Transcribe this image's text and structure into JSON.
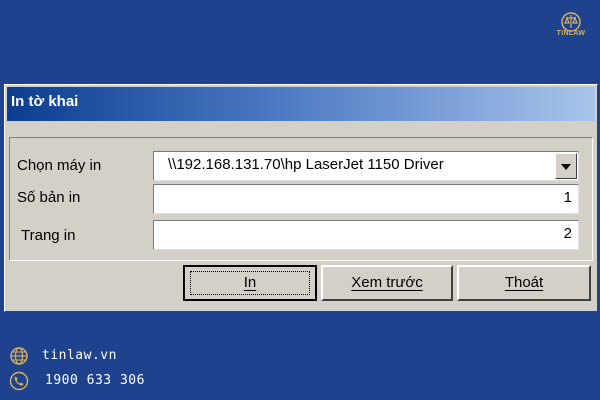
{
  "brand": {
    "logo_text": "TINLAW",
    "accent_color": "#d8b25a",
    "background_color": "#1e428e"
  },
  "dialog": {
    "title": "In tờ khai",
    "printer_label": "Chọn máy in",
    "printer_value": "\\\\192.168.131.70\\hp LaserJet 1150 Driver",
    "copies_label": "Số bản in",
    "copies_value": "1",
    "page_label": "Trang in",
    "page_value": "2",
    "buttons": {
      "print": "In",
      "preview": "Xem trước",
      "exit": "Thoát"
    }
  },
  "footer": {
    "website": "tinlaw.vn",
    "website_icon": "globe-icon",
    "phone": "1900 633 306",
    "phone_icon": "phone-icon"
  }
}
